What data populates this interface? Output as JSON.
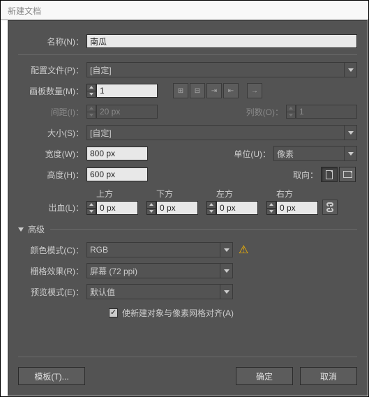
{
  "window": {
    "title": "新建文档"
  },
  "labels": {
    "name": "名称(N)：",
    "profile": "配置文件(P)：",
    "artboards": "画板数量(M)：",
    "spacing": "间距(I)：",
    "columns": "列数(O)：",
    "size": "大小(S)：",
    "width": "宽度(W)：",
    "height": "高度(H)：",
    "units": "单位(U)：",
    "orientation": "取向：",
    "bleed": "出血(L)：",
    "bleed_top": "上方",
    "bleed_bottom": "下方",
    "bleed_left": "左方",
    "bleed_right": "右方",
    "advanced": "高级",
    "color_mode": "颜色模式(C)：",
    "raster_effects": "栅格效果(R)：",
    "preview_mode": "预览模式(E)：",
    "align_to_grid": "使新建对象与像素网格对齐(A)"
  },
  "values": {
    "name": "南瓜",
    "profile": "[自定]",
    "artboards": "1",
    "spacing": "20 px",
    "columns": "1",
    "size": "[自定]",
    "width": "800 px",
    "height": "600 px",
    "units": "像素",
    "bleed_top": "0 px",
    "bleed_bottom": "0 px",
    "bleed_left": "0 px",
    "bleed_right": "0 px",
    "color_mode": "RGB",
    "raster_effects": "屏幕 (72 ppi)",
    "preview_mode": "默认值",
    "align_checked": "✓"
  },
  "buttons": {
    "template": "模板(T)...",
    "ok": "确定",
    "cancel": "取消"
  }
}
